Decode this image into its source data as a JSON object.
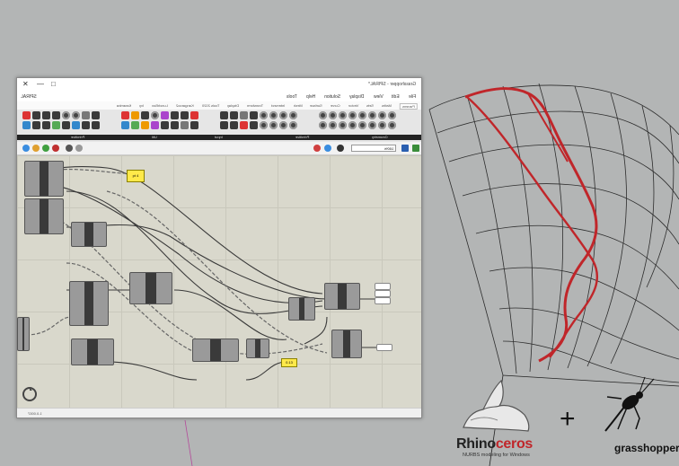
{
  "window": {
    "title": "Grasshopper - SPIRAL*",
    "min_glyph": "—",
    "max_glyph": "□",
    "close_glyph": "✕"
  },
  "menubar": {
    "app_name": "SPIRAL",
    "items": [
      "File",
      "Edit",
      "View",
      "Display",
      "Solution",
      "Help",
      "Tools"
    ]
  },
  "tabs": {
    "items": [
      "Params",
      "Maths",
      "Sets",
      "Vector",
      "Curve",
      "Surface",
      "Mesh",
      "Intersect",
      "Transform",
      "Display",
      "Tools 2020",
      "Kangaroo2",
      "LunchBox",
      "Ivy",
      "Karamba"
    ],
    "active": "Params"
  },
  "category_bar": [
    "Geometry",
    "Primitive",
    "Input",
    "Util",
    "Primitive"
  ],
  "canvas_toolbar": {
    "zoom": "100%"
  },
  "status": {
    "version": "1.0.0007"
  },
  "panels": [
    {
      "id": "panel-1",
      "text": "pt 4"
    },
    {
      "id": "panel-2",
      "text": "0.13"
    }
  ],
  "logos": {
    "rhino_word_black": "Rhino",
    "rhino_word_red": "ceros",
    "rhino_tagline": "NURBS modeling for Windows",
    "plus_sign": "+",
    "grasshopper_word": "grasshopper"
  },
  "colors": {
    "canvas_bg": "#d9d8cc",
    "viewport_bg": "#b3b5b5",
    "selected_curve": "#c0262a",
    "panel_yellow": "#ffe94a"
  }
}
